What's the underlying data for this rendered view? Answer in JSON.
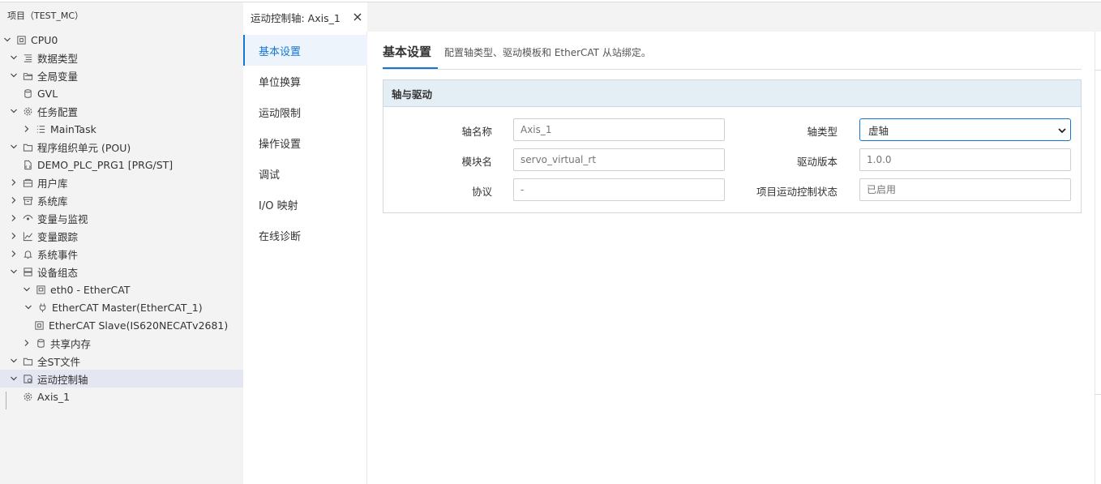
{
  "sidebar": {
    "title": "项目（TEST_MC）",
    "tree": [
      {
        "label": "CPU0",
        "icon": "chip-icon",
        "expand": "open",
        "indent": 0
      },
      {
        "label": "数据类型",
        "icon": "type-list-icon",
        "expand": "open",
        "indent": 1
      },
      {
        "label": "全局变量",
        "icon": "folder-open-icon",
        "expand": "open",
        "indent": 1
      },
      {
        "label": "GVL",
        "icon": "database-icon",
        "expand": "none",
        "indent": 2
      },
      {
        "label": "任务配置",
        "icon": "gear-icon",
        "expand": "open",
        "indent": 1
      },
      {
        "label": "MainTask",
        "icon": "task-list-icon",
        "expand": "closed",
        "indent": 2
      },
      {
        "label": "程序组织单元 (POU)",
        "icon": "folder-icon",
        "expand": "open",
        "indent": 1
      },
      {
        "label": "DEMO_PLC_PRG1 [PRG/ST]",
        "icon": "code-file-icon",
        "expand": "none",
        "indent": 2
      },
      {
        "label": "用户库",
        "icon": "package-icon",
        "expand": "closed",
        "indent": 1
      },
      {
        "label": "系统库",
        "icon": "archive-icon",
        "expand": "closed",
        "indent": 1
      },
      {
        "label": "变量与监视",
        "icon": "eye-icon",
        "expand": "closed",
        "indent": 1
      },
      {
        "label": "变量跟踪",
        "icon": "chart-line-icon",
        "expand": "closed",
        "indent": 1
      },
      {
        "label": "系统事件",
        "icon": "bell-icon",
        "expand": "closed",
        "indent": 1
      },
      {
        "label": "设备组态",
        "icon": "server-icon",
        "expand": "open",
        "indent": 1
      },
      {
        "label": "eth0 - EtherCAT",
        "icon": "network-card-icon",
        "expand": "open",
        "indent": 2
      },
      {
        "label": "EtherCAT Master(EtherCAT_1)",
        "icon": "plug-icon",
        "expand": "open",
        "indent": 3
      },
      {
        "label": "EtherCAT Slave(IS620NECATv2681)",
        "icon": "chip-icon",
        "expand": "none",
        "indent": 4
      },
      {
        "label": "共享内存",
        "icon": "database-icon",
        "expand": "closed",
        "indent": 2
      },
      {
        "label": "全ST文件",
        "icon": "folder-icon",
        "expand": "open",
        "indent": 1
      },
      {
        "label": "运动控制轴",
        "icon": "axis-gear-icon",
        "expand": "open",
        "indent": 1,
        "selected": true
      },
      {
        "label": "Axis_1",
        "icon": "gear-icon",
        "expand": "none",
        "indent": 2
      }
    ]
  },
  "tab": {
    "label": "运动控制轴: Axis_1",
    "close_icon": "close-icon"
  },
  "settings_nav": {
    "items": [
      {
        "label": "基本设置",
        "active": true
      },
      {
        "label": "单位换算"
      },
      {
        "label": "运动限制"
      },
      {
        "label": "操作设置"
      },
      {
        "label": "调试"
      },
      {
        "label": "I/O 映射"
      },
      {
        "label": "在线诊断"
      }
    ]
  },
  "main": {
    "heading": "基本设置",
    "description": "配置轴类型、驱动模板和 EtherCAT 从站绑定。",
    "panel": {
      "title": "轴与驱动",
      "fields": {
        "axis_name_label": "轴名称",
        "axis_name_placeholder": "Axis_1",
        "module_label": "模块名",
        "module_placeholder": "servo_virtual_rt",
        "protocol_label": "协议",
        "protocol_placeholder": "-",
        "axis_type_label": "轴类型",
        "axis_type_value": "虚轴",
        "driver_version_label": "驱动版本",
        "driver_version_placeholder": "1.0.0",
        "mc_status_label": "项目运动控制状态",
        "mc_status_placeholder": "已启用"
      }
    }
  },
  "colors": {
    "accent": "#1677d2",
    "sidebar_bg": "#f3f3f3",
    "selected_row": "#e4e6f1",
    "panel_head_bg": "#e4eef5"
  }
}
